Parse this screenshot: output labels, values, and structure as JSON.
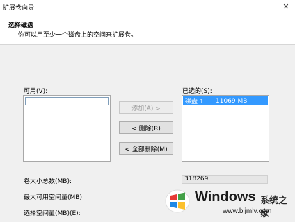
{
  "window": {
    "title": "扩展卷向导",
    "close_glyph": "✕"
  },
  "header": {
    "title": "选择磁盘",
    "subtitle": "你可以用至少一个磁盘上的空间来扩展卷。"
  },
  "available": {
    "label": "可用(V):"
  },
  "selected": {
    "label": "已选的(S):",
    "items": [
      {
        "disk": "磁盘 1",
        "size": "11069 MB"
      }
    ],
    "selection_color": "#3399ff"
  },
  "buttons": {
    "add": "添加(A) >",
    "remove": "< 删除(R)",
    "remove_all": "< 全部删除(M)"
  },
  "fields": {
    "total_label": "卷大小总数(MB):",
    "total_value": "318269",
    "max_label": "最大可用空间量(MB):",
    "select_label": "选择空间量(MB)(E):"
  },
  "watermark": {
    "brand": "Windows",
    "brand_cn": "系统之家",
    "url": "www.bjjmlv.com",
    "colors": [
      "#e53935",
      "#43a047",
      "#1e88e5",
      "#fbc02d"
    ]
  }
}
